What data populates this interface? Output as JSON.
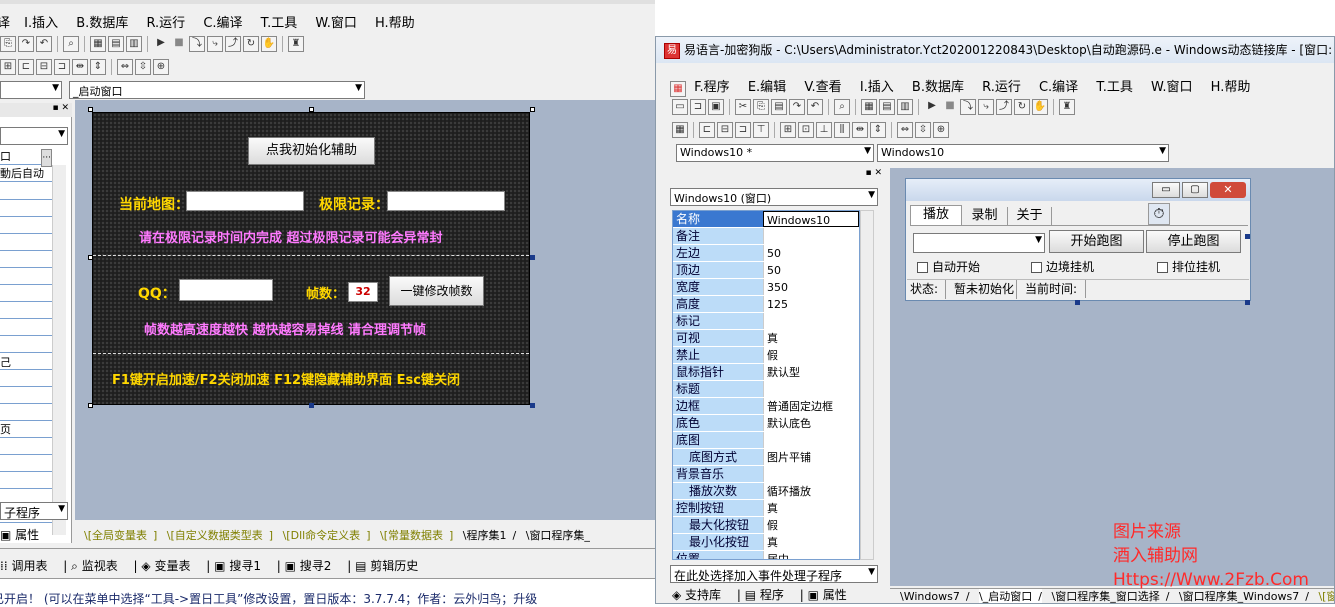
{
  "left_window": {
    "menu": [
      "E.编辑",
      "I.插入",
      "B.数据库",
      "R.运行",
      "C.编译",
      "T.工具",
      "W.窗口",
      "H.帮助"
    ],
    "window_combo": "_启动窗口",
    "left_panel": {
      "row1": "口",
      "row2": "動后自动",
      "frag_a": "己",
      "frag_b": "页",
      "bottom_label": "子程序",
      "tab_property": "属性"
    },
    "form": {
      "init_button": "点我初始化辅助",
      "current_map_label": "当前地图：",
      "limit_record_label": "极限记录：",
      "hint1": "请在极限记录时间内完成  超过极限记录可能会异常封",
      "qq_label": "QQ：",
      "fps_label": "帧数：",
      "fps_value": "32",
      "fps_button": "一键修改帧数",
      "hint2": "帧数越高速度越快  越快越容易掉线  请合理调节帧",
      "hint3": "F1键开启加速/F2关闭加速  F12键隐藏辅助界面  Esc键关闭"
    },
    "bottom_tabs": [
      "全局变量表",
      "自定义数据类型表",
      "Dll命令定义表",
      "常量数据表",
      "程序集1",
      "窗口程序集_"
    ],
    "status_tabs": [
      "调用表",
      "监视表",
      "变量表",
      "搜寻1",
      "搜寻2",
      "剪辑历史"
    ],
    "status_text": "已开启！   (可以在菜单中选择“工具->置日工具”修改设置，置日版本：3.7.7.4；作者：云外归鸟；升级"
  },
  "right_window": {
    "title": "易语言-加密狗版 - C:\\Users\\Administrator.Yct202001220843\\Desktop\\自动跑源码.e - Windows动态链接库 - [窗口: Windo",
    "menu": [
      "F.程序",
      "E.编辑",
      "V.查看",
      "I.插入",
      "B.数据库",
      "R.运行",
      "C.编译",
      "T.工具",
      "W.窗口",
      "H.帮助"
    ],
    "combo1": "Windows10 *",
    "combo2": "Windows10",
    "prop_combo": "Windows10 (窗口)",
    "properties": [
      {
        "k": "名称",
        "v": "Windows10"
      },
      {
        "k": "备注",
        "v": ""
      },
      {
        "k": "左边",
        "v": "50"
      },
      {
        "k": "顶边",
        "v": "50"
      },
      {
        "k": "宽度",
        "v": "350"
      },
      {
        "k": "高度",
        "v": "125"
      },
      {
        "k": "标记",
        "v": ""
      },
      {
        "k": "可视",
        "v": "真"
      },
      {
        "k": "禁止",
        "v": "假"
      },
      {
        "k": "鼠标指针",
        "v": "默认型"
      },
      {
        "k": "标题",
        "v": ""
      },
      {
        "k": "边框",
        "v": "普通固定边框"
      },
      {
        "k": "底色",
        "v": "默认底色"
      },
      {
        "k": "底图",
        "v": ""
      },
      {
        "k": "底图方式",
        "v": "图片平铺"
      },
      {
        "k": "背景音乐",
        "v": ""
      },
      {
        "k": "播放次数",
        "v": "循环播放"
      },
      {
        "k": "控制按钮",
        "v": "真"
      },
      {
        "k": "最大化按钮",
        "v": "假"
      },
      {
        "k": "最小化按钮",
        "v": "真"
      },
      {
        "k": "位置",
        "v": "居中"
      }
    ],
    "event_combo": "在此处选择加入事件处理子程序",
    "panel_tabs": [
      "支持库",
      "程序",
      "属性"
    ],
    "bottom_tabs": [
      "Windows7",
      "_启动窗口",
      "窗口程序集_窗口选择",
      "窗口程序集_Windows7",
      "窗"
    ],
    "sub_form": {
      "tabs": [
        "播放",
        "录制",
        "关于"
      ],
      "start_button": "开始跑图",
      "stop_button": "停止跑图",
      "auto_start": "自动开始",
      "edge_hang": "边境挂机",
      "rank_hang": "排位挂机",
      "status_label": "状态:",
      "status_value": "暂未初始化",
      "time_label": "当前时间:"
    }
  },
  "watermark": [
    "图片来源",
    "酒入辅助网",
    "Https://Www.2Fzb.Com"
  ]
}
